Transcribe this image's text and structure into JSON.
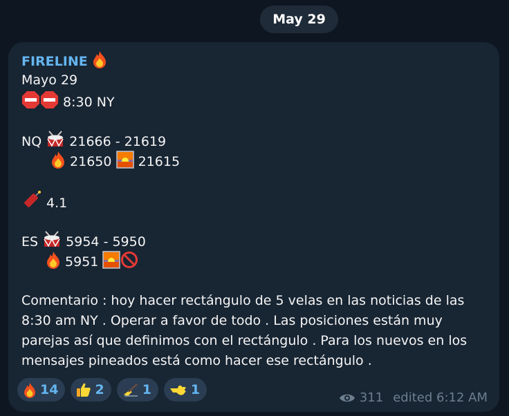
{
  "date_separator": "May 29",
  "message": {
    "author": "FIRELINE",
    "lines": {
      "date": "Mayo 29",
      "time": "8:30 NY",
      "nq_label": "NQ",
      "nq_range": "21666 - 21619",
      "nq_fire": "21650",
      "nq_sunrise": "21615",
      "dyn_value": "4.1",
      "es_label": "ES",
      "es_range": "5954 - 5950",
      "es_fire": "5951"
    },
    "comment": "Comentario : hoy hacer rectángulo  de 5 velas en las noticias de las 8:30 am NY . Operar a favor de todo . Las posiciones están muy parejas así que definimos con el rectángulo .  Para los nuevos en los mensajes pineados está como hacer ese rectángulo ."
  },
  "reactions": [
    {
      "icon": "fire-icon",
      "count": "14"
    },
    {
      "icon": "thumbs-up-icon",
      "count": "2"
    },
    {
      "icon": "writing-hand-icon",
      "count": "1"
    },
    {
      "icon": "pointing-hand-icon",
      "count": "1"
    }
  ],
  "meta": {
    "views": "311",
    "edited": "edited 6:12 AM"
  },
  "colors": {
    "background": "#0e1621",
    "bubble": "#182533",
    "author": "#64b5ef",
    "reaction_chip": "#2b3d52"
  }
}
